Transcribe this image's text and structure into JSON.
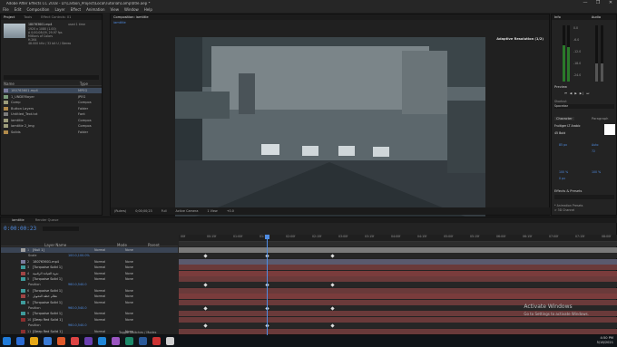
{
  "window": {
    "title": "Adobe After Effects CC 2018 - D:\\Carbon_Project\\Local\\Tutorial\\Comp\\title.aep *",
    "controls": [
      "—",
      "❐",
      "✕"
    ]
  },
  "menu": [
    "File",
    "Edit",
    "Composition",
    "Layer",
    "Effect",
    "Animation",
    "View",
    "Window",
    "Help"
  ],
  "project": {
    "tabs": [
      "Project",
      "Tools",
      "Effect Controls: 01"
    ],
    "selected_name": "180763601.mp4",
    "selected_used": "used 1 time",
    "info_lines": [
      "1920 x 1080 (1.00)",
      "Δ 0;00;08;09, 29.97 fps",
      "Millions of Colors",
      "H.264",
      "48.000 kHz / 32 bit U / Stereo"
    ],
    "search_placeholder": "",
    "col_name": "Name",
    "col_type": "Type",
    "items": [
      {
        "name": "180763601.mp4",
        "type": "MPEG",
        "color": "#7b7b9c"
      },
      {
        "name": "1_UNDERlayer",
        "type": "JPEG",
        "color": "#7b9c7b"
      },
      {
        "name": "Comp",
        "type": "Compos",
        "color": "#9c9c7b"
      },
      {
        "name": "Button Layers",
        "type": "Folder",
        "color": "#b08a4a"
      },
      {
        "name": "Untitled_Text.txt",
        "type": "Font",
        "color": "#7b7b7b"
      },
      {
        "name": "iamtitle",
        "type": "Compos",
        "color": "#9c9c7b"
      },
      {
        "name": "iamtitle 2_Img",
        "type": "Compos",
        "color": "#9c9c7b"
      },
      {
        "name": "Solids",
        "type": "Folder",
        "color": "#b08a4a"
      }
    ]
  },
  "composition": {
    "tab": "Composition: iamtitle",
    "sub_tab": "iamtitle",
    "adaptive": "Adaptive Resolution (1/2)",
    "toolbar": [
      "(Rulers)",
      "0;00;00;23",
      "Full",
      "Active Camera",
      "1 View",
      "+0.0"
    ]
  },
  "right_panels": {
    "info_tab": "Info",
    "audio_tab": "Audio",
    "meter_labels": [
      "0.0",
      "-6.0",
      "-12.0",
      "-18.0",
      "-24.0"
    ],
    "preview": "Preview",
    "shortcut_label": "Shortcut",
    "shortcut_value": "Spacebar",
    "character": "Character",
    "paragraph": "Paragraph",
    "font": "Fruitiger LT Arabic",
    "font_style": "45 Bold",
    "font_size": "85 px",
    "leading": "Auto",
    "tracking": "72",
    "scale_v": "100 %",
    "scale_h": "100 %",
    "baseline": "0 px",
    "effects_presets": "Effects & Presets",
    "presets": [
      "* Animation Presets",
      "> 3D Channel"
    ]
  },
  "timeline": {
    "tabs": [
      "iamtitle",
      "Render Queue"
    ],
    "timecode": "0:00:00:23",
    "col_source": "Layer Name",
    "col_mode": "Mode",
    "col_parent": "Parent",
    "ticks": [
      "00f",
      "00:15f",
      "01:00f",
      "01:15f",
      "02:00f",
      "02:15f",
      "03:00f",
      "03:15f",
      "04:00f",
      "04:15f",
      "05:00f",
      "05:15f",
      "06:00f",
      "06:15f",
      "07:00f",
      "07:15f",
      "08:00f"
    ],
    "layers": [
      {
        "num": "1",
        "name": "[Null 1]",
        "mode": "Normal",
        "parent": "None",
        "kind": "layer",
        "color": "#a0a0a0",
        "bar": "#7a7a7a",
        "sel": true
      },
      {
        "num": "",
        "name": "Scale",
        "mode": "",
        "parent": "",
        "kind": "prop",
        "value": "100.0,100.0%",
        "bar": "#262626"
      },
      {
        "num": "2",
        "name": "180763601.mp4",
        "mode": "Normal",
        "parent": "None",
        "kind": "layer",
        "color": "#7b7b9c",
        "bar": "#5a5a6e"
      },
      {
        "num": "3",
        "name": "[Turquoise Solid 1]",
        "mode": "Normal",
        "parent": "None",
        "kind": "layer",
        "color": "#3f9b9b",
        "bar": "#6a3a3a"
      },
      {
        "num": "4",
        "name": "ندوة القيادة الرقمية",
        "mode": "Normal",
        "parent": "None",
        "kind": "layer",
        "color": "#a04545",
        "bar": "#7a3c3c"
      },
      {
        "num": "5",
        "name": "[Turquoise Solid 1]",
        "mode": "Normal",
        "parent": "None",
        "kind": "layer",
        "color": "#3f9b9b",
        "bar": "#6a3a3a"
      },
      {
        "num": "",
        "name": "Position",
        "mode": "",
        "parent": "",
        "kind": "prop",
        "value": "960.0,540.0",
        "bar": "#262626"
      },
      {
        "num": "6",
        "name": "[Turquoise Solid 1]",
        "mode": "Normal",
        "parent": "None",
        "kind": "layer",
        "color": "#3f9b9b",
        "bar": "#6a3a3a"
      },
      {
        "num": "7",
        "name": "نظام خطة التحويل",
        "mode": "Normal",
        "parent": "None",
        "kind": "layer",
        "color": "#a04545",
        "bar": "#7a3c3c"
      },
      {
        "num": "8",
        "name": "[Turquoise Solid 1]",
        "mode": "Normal",
        "parent": "None",
        "kind": "layer",
        "color": "#3f9b9b",
        "bar": "#6a3a3a"
      },
      {
        "num": "",
        "name": "Position",
        "mode": "",
        "parent": "",
        "kind": "prop",
        "value": "960.0,540.0",
        "bar": "#262626"
      },
      {
        "num": "9",
        "name": "[Turquoise Solid 1]",
        "mode": "Normal",
        "parent": "None",
        "kind": "layer",
        "color": "#3f9b9b",
        "bar": "#6a3a3a"
      },
      {
        "num": "10",
        "name": "[Deep Red Solid 1]",
        "mode": "Normal",
        "parent": "None",
        "kind": "layer",
        "color": "#8c2f2f",
        "bar": "#6a3a3a"
      },
      {
        "num": "",
        "name": "Position",
        "mode": "",
        "parent": "",
        "kind": "prop",
        "value": "960.0,540.0",
        "bar": "#262626"
      },
      {
        "num": "11",
        "name": "[Deep Red Solid 1]",
        "mode": "Normal",
        "parent": "None",
        "kind": "layer",
        "color": "#8c2f2f",
        "bar": "#6a3a3a"
      }
    ],
    "toggle": "Toggle Switches / Modes"
  },
  "watermark": {
    "line1": "Activate Windows",
    "line2": "Go to Settings to activate Windows."
  },
  "taskbar": {
    "time": "4:50 PM",
    "date": "5/18/2021",
    "apps": [
      "#2b6cd4",
      "#e6a817",
      "#3a7bd5",
      "#e05a2b",
      "#d44",
      "#6a3fb0",
      "#1f86d8",
      "#9a55c0",
      "#1c8a6a",
      "#2a5a9a",
      "#c33",
      "#d0d0d0"
    ]
  }
}
